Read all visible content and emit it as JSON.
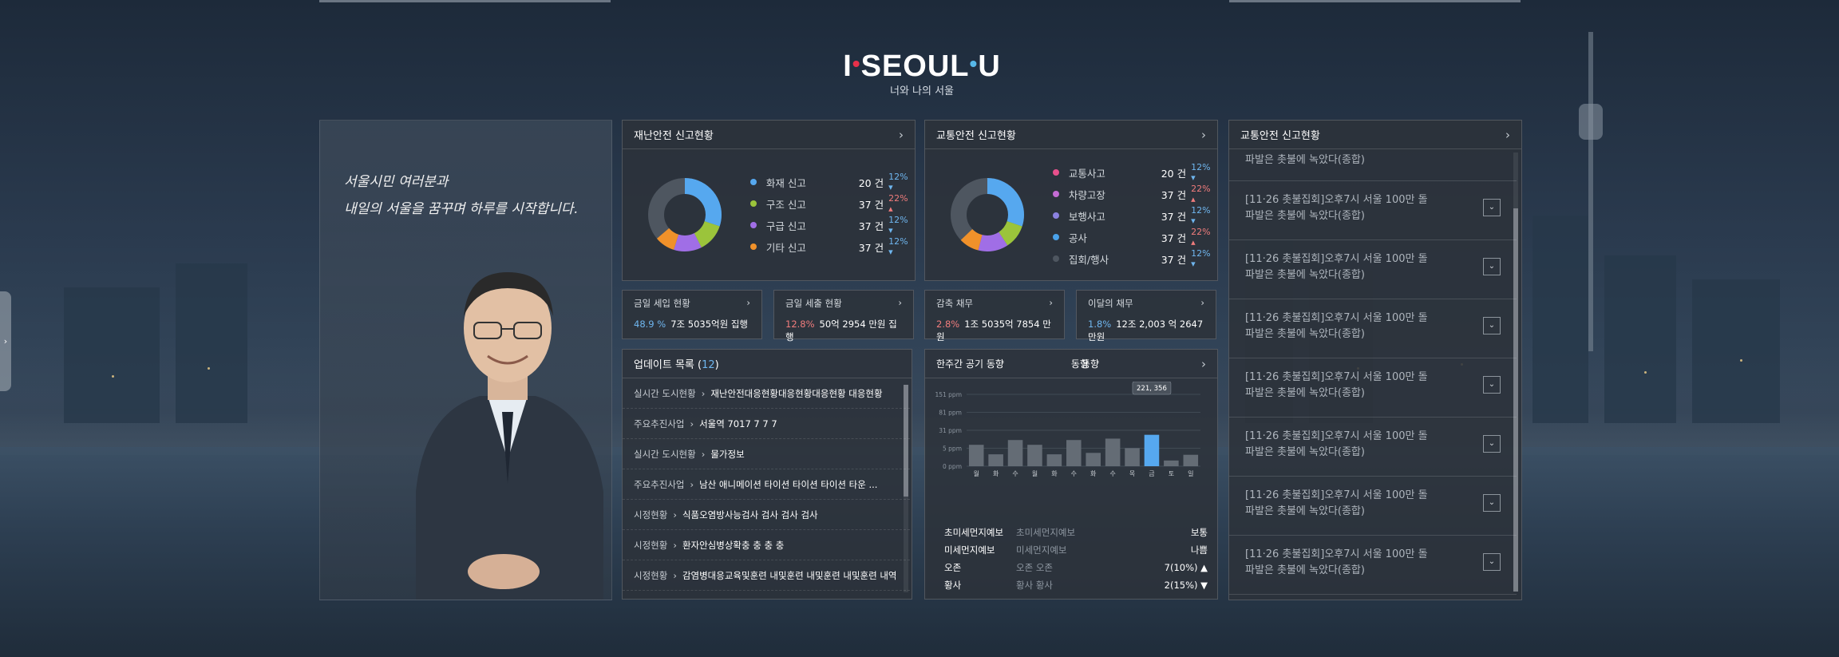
{
  "brand": {
    "logo_left": "I",
    "logo_mid": "SE",
    "logo_o": "O",
    "logo_ul": "UL",
    "logo_u": "U",
    "subtitle": "너와 나의 서울"
  },
  "greeting": "서울시민 여러분과\n내일의 서울을 꿈꾸며 하루를 시작합니다.",
  "colors": {
    "blue": "#56a8ef",
    "olive": "#9bc43b",
    "purple": "#a06ee6",
    "orange": "#f0912a",
    "pink": "#e8508c",
    "magenta": "#c46cd4",
    "violet": "#8b82e0",
    "sky": "#4aa2ea",
    "gray": "#4e5660",
    "up": "#f07c7c",
    "down": "#6fb6ef"
  },
  "disaster": {
    "title": "재난안전 신고현황",
    "items": [
      {
        "name": "화재 신고",
        "count": "20 건",
        "pct": "12%",
        "dir": "down"
      },
      {
        "name": "구조 신고",
        "count": "37 건",
        "pct": "22%",
        "dir": "up"
      },
      {
        "name": "구급 신고",
        "count": "37 건",
        "pct": "12%",
        "dir": "down"
      },
      {
        "name": "기타 신고",
        "count": "37 건",
        "pct": "12%",
        "dir": "down"
      }
    ]
  },
  "traffic": {
    "title": "교통안전 신고현황",
    "items": [
      {
        "name": "교통사고",
        "count": "20 건",
        "pct": "12%",
        "dir": "down"
      },
      {
        "name": "차량고장",
        "count": "37 건",
        "pct": "22%",
        "dir": "up"
      },
      {
        "name": "보행사고",
        "count": "37 건",
        "pct": "12%",
        "dir": "down"
      },
      {
        "name": "공사",
        "count": "37 건",
        "pct": "22%",
        "dir": "up"
      },
      {
        "name": "집회/행사",
        "count": "37 건",
        "pct": "12%",
        "dir": "down"
      }
    ]
  },
  "finance": [
    {
      "title": "금일 세입 현황",
      "pct": "48.9 %",
      "value": "7조 5035억원 집행",
      "dir": "down"
    },
    {
      "title": "금일 세출 현황",
      "pct": "12.8%",
      "value": "50억 2954 만원 집행",
      "dir": "up"
    },
    {
      "title": "감축 채무",
      "pct": "2.8%",
      "value": "1조 5035억 7854 만원",
      "dir": "up"
    },
    {
      "title": "이달의 채무",
      "pct": "1.8%",
      "value": "12조 2,003 억 2647 만원",
      "dir": "down"
    }
  ],
  "updates": {
    "title_prefix": "업데이트 목록 (",
    "count": "12",
    "title_suffix": ")",
    "rows": [
      {
        "cat": "실시간 도시현황",
        "text": "재난안전대응현황대응현황대응현황 대응현황"
      },
      {
        "cat": "주요추진사업",
        "text": "서울역 7017       7          7          7"
      },
      {
        "cat": "실시간 도시현황",
        "text": "물가정보"
      },
      {
        "cat": "주요추진사업",
        "text": "남산 애니메이션 타이션 타이션 타이션 타운 ..."
      },
      {
        "cat": "시정현황",
        "text": "식품오염방사능검사        검사       검사       검사"
      },
      {
        "cat": "시정현황",
        "text": "환자안심병상확충        충          충          충"
      },
      {
        "cat": "시정현황",
        "text": "감염병대응교육및훈련 내및훈련 내및훈련 내및훈련 내역"
      }
    ]
  },
  "air": {
    "tabs": [
      "한주간 공기 동향",
      "한주간 공기 동향",
      "동향"
    ],
    "ylabels": [
      "151 ppm",
      "81 ppm",
      "31 ppm",
      "5 ppm",
      "0 ppm"
    ],
    "days": [
      "월",
      "화",
      "수",
      "월",
      "화",
      "수",
      "화",
      "수",
      "목",
      "금",
      "토",
      "일"
    ],
    "tooltip": "221, 356",
    "rows": [
      {
        "k": "초미세먼지예보",
        "ghost": "초미세먼지예보",
        "v": "보통"
      },
      {
        "k": "미세먼지예보",
        "ghost": "미세먼지예보",
        "v": "나쁨"
      },
      {
        "k": "오존",
        "ghost": "오존   오존",
        "v": "7(10%) ▲"
      },
      {
        "k": "황사",
        "ghost": "황사   황사",
        "v": "2(15%) ▼"
      }
    ]
  },
  "chart_data": {
    "type": "bar",
    "categories": [
      "월",
      "화",
      "수",
      "월",
      "화",
      "수",
      "화",
      "수",
      "목",
      "금",
      "토",
      "일"
    ],
    "values": [
      45,
      25,
      55,
      45,
      25,
      55,
      28,
      58,
      38,
      66,
      12,
      24
    ],
    "ylim": [
      0,
      151
    ],
    "highlight_index": 9,
    "tooltip": "221, 356"
  },
  "news": {
    "title": "교통안전 신고현황",
    "top_partial": "파발은 촛불에 녹았다(종합)",
    "items": [
      {
        "l1": "[11·26 촛불집회]오후7시 서울 100만 돌",
        "l2": "파발은 촛불에 녹았다(종합)"
      },
      {
        "l1": "[11·26 촛불집회]오후7시 서울 100만 돌",
        "l2": "파발은 촛불에 녹았다(종합)"
      },
      {
        "l1": "[11·26 촛불집회]오후7시 서울 100만 돌",
        "l2": "파발은 촛불에 녹았다(종합)"
      },
      {
        "l1": "[11·26 촛불집회]오후7시 서울 100만 돌",
        "l2": "파발은 촛불에 녹았다(종합)"
      },
      {
        "l1": "[11·26 촛불집회]오후7시 서울 100만 돌",
        "l2": "파발은 촛불에 녹았다(종합)"
      },
      {
        "l1": "[11·26 촛불집회]오후7시 서울 100만 돌",
        "l2": "파발은 촛불에 녹았다(종합)"
      },
      {
        "l1": "[11·26 촛불집회]오후7시 서울 100만 돌",
        "l2": "파발은 촛불에 녹았다(종합)"
      }
    ]
  }
}
